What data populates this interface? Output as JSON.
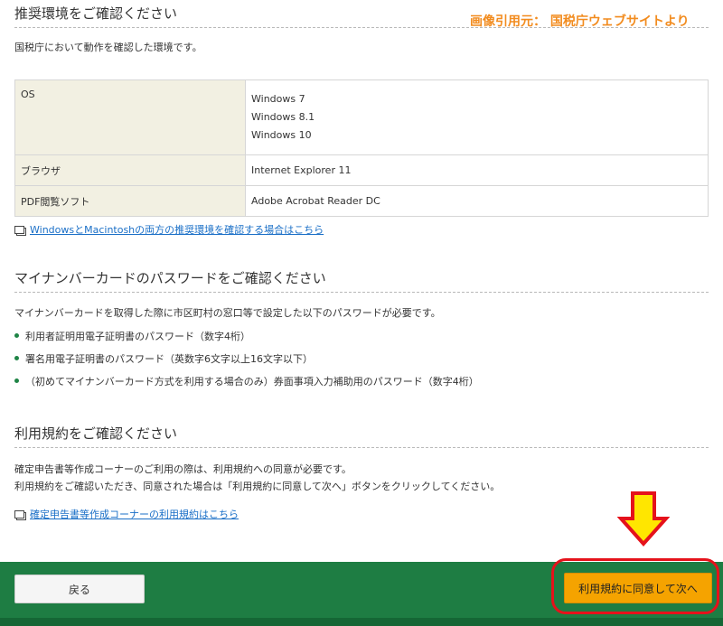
{
  "source_note": "画像引用元： 国税庁ウェブサイトより",
  "env_section": {
    "heading": "推奨環境をご確認ください",
    "intro": "国税庁において動作を確認した環境です。",
    "rows": [
      {
        "label": "OS",
        "values": [
          "Windows 7",
          "Windows 8.1",
          "Windows 10"
        ]
      },
      {
        "label": "ブラウザ",
        "values": [
          "Internet Explorer 11"
        ]
      },
      {
        "label": "PDF閲覧ソフト",
        "values": [
          "Adobe Acrobat Reader DC"
        ]
      }
    ],
    "link": "WindowsとMacintoshの両方の推奨環境を確認する場合はこちら"
  },
  "card_section": {
    "heading": "マイナンバーカードのパスワードをご確認ください",
    "intro": "マイナンバーカードを取得した際に市区町村の窓口等で設定した以下のパスワードが必要です。",
    "items": [
      "利用者証明用電子証明書のパスワード（数字4桁）",
      "署名用電子証明書のパスワード（英数字6文字以上16文字以下）",
      "（初めてマイナンバーカード方式を利用する場合のみ）券面事項入力補助用のパスワード（数字4桁）"
    ]
  },
  "terms_section": {
    "heading": "利用規約をご確認ください",
    "line1": "確定申告書等作成コーナーのご利用の際は、利用規約への同意が必要です。",
    "line2": "利用規約をご確認いただき、同意された場合は「利用規約に同意して次へ」ボタンをクリックしてください。",
    "link": "確定申告書等作成コーナーの利用規約はこちら"
  },
  "footer": {
    "back_label": "戻る",
    "agree_label": "利用規約に同意して次へ"
  },
  "annotation_colors": {
    "arrow_fill": "#ffe600",
    "arrow_stroke": "#e5121b",
    "ring": "#e5121b",
    "footer_bg": "#1e7d43",
    "agree_button": "#f5a300"
  }
}
